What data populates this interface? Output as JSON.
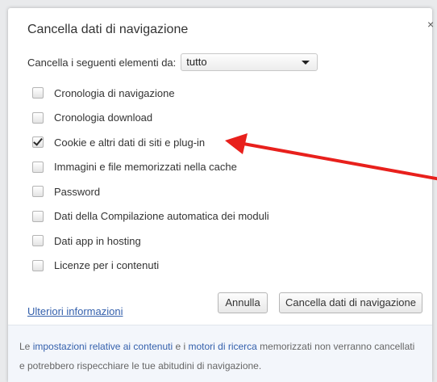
{
  "dialog": {
    "title": "Cancella dati di navigazione",
    "close_glyph": "×",
    "close_icon": "close-icon"
  },
  "range": {
    "label": "Cancella i seguenti elementi da:",
    "value": "tutto"
  },
  "items": [
    {
      "label": "Cronologia di navigazione",
      "checked": false
    },
    {
      "label": "Cronologia download",
      "checked": false
    },
    {
      "label": "Cookie e altri dati di siti e plug-in",
      "checked": true
    },
    {
      "label": "Immagini e file memorizzati nella cache",
      "checked": false
    },
    {
      "label": "Password",
      "checked": false
    },
    {
      "label": "Dati della Compilazione automatica dei moduli",
      "checked": false
    },
    {
      "label": "Dati app in hosting",
      "checked": false
    },
    {
      "label": "Licenze per i contenuti",
      "checked": false
    }
  ],
  "links": {
    "more_info": "Ulteriori informazioni"
  },
  "buttons": {
    "cancel": "Annulla",
    "clear": "Cancella dati di navigazione"
  },
  "footer": {
    "t1": "Le ",
    "link1": "impostazioni relative ai contenuti",
    "t2": " e i ",
    "link2": "motori di ricerca",
    "t3": " memorizzati non verranno cancellati e potrebbero rispecchiare le tue abitudini di navigazione."
  },
  "annotation": {
    "arrow_color": "#e8201c"
  },
  "colors": {
    "link": "#3460ac",
    "footer_bg": "#f3f6fb"
  }
}
